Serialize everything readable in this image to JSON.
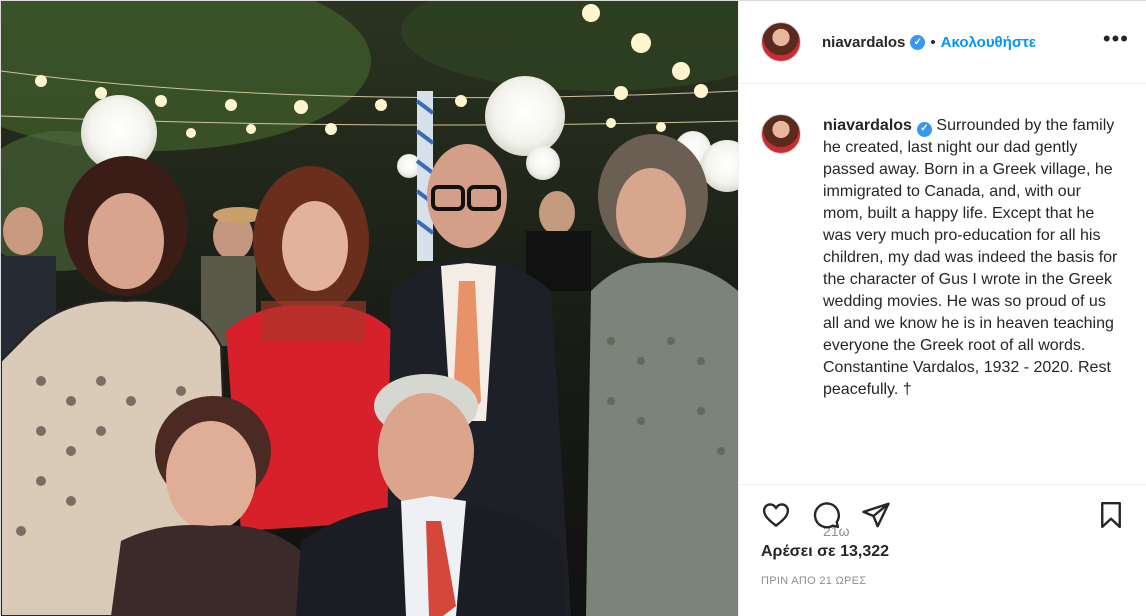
{
  "post": {
    "username": "niavardalos",
    "verified": true,
    "separator": "•",
    "follow_label": "Ακολουθήστε",
    "more_label": "•••",
    "caption_username": "niavardalos",
    "caption_text": "Surrounded by the family he created, last night our dad gently passed away. Born in a Greek village, he immigrated to Canada, and, with our mom, built a happy life. Except that he was very much pro-education for all his children, my dad was indeed the basis for the character of Gus I wrote in the Greek wedding movies. He was so proud of us all and we know he is in heaven teaching everyone the Greek root of all words. Constantine Vardalos, 1932 - 2020. Rest peacefully. †",
    "relative_time": "21ω",
    "likes_label": "Αρέσει σε 13,322",
    "timestamp": "ΠΡΙΝ ΑΠΟ 21 ΩΡΕΣ"
  },
  "icons": {
    "like": "heart-outline-icon",
    "comment": "comment-bubble-icon",
    "share": "paper-plane-icon",
    "save": "bookmark-icon",
    "verified": "verified-check-icon",
    "more": "more-options-icon"
  },
  "colors": {
    "link_blue": "#0095f6",
    "verified_blue": "#3897f0",
    "text": "#262626",
    "muted": "#8e8e8e"
  }
}
